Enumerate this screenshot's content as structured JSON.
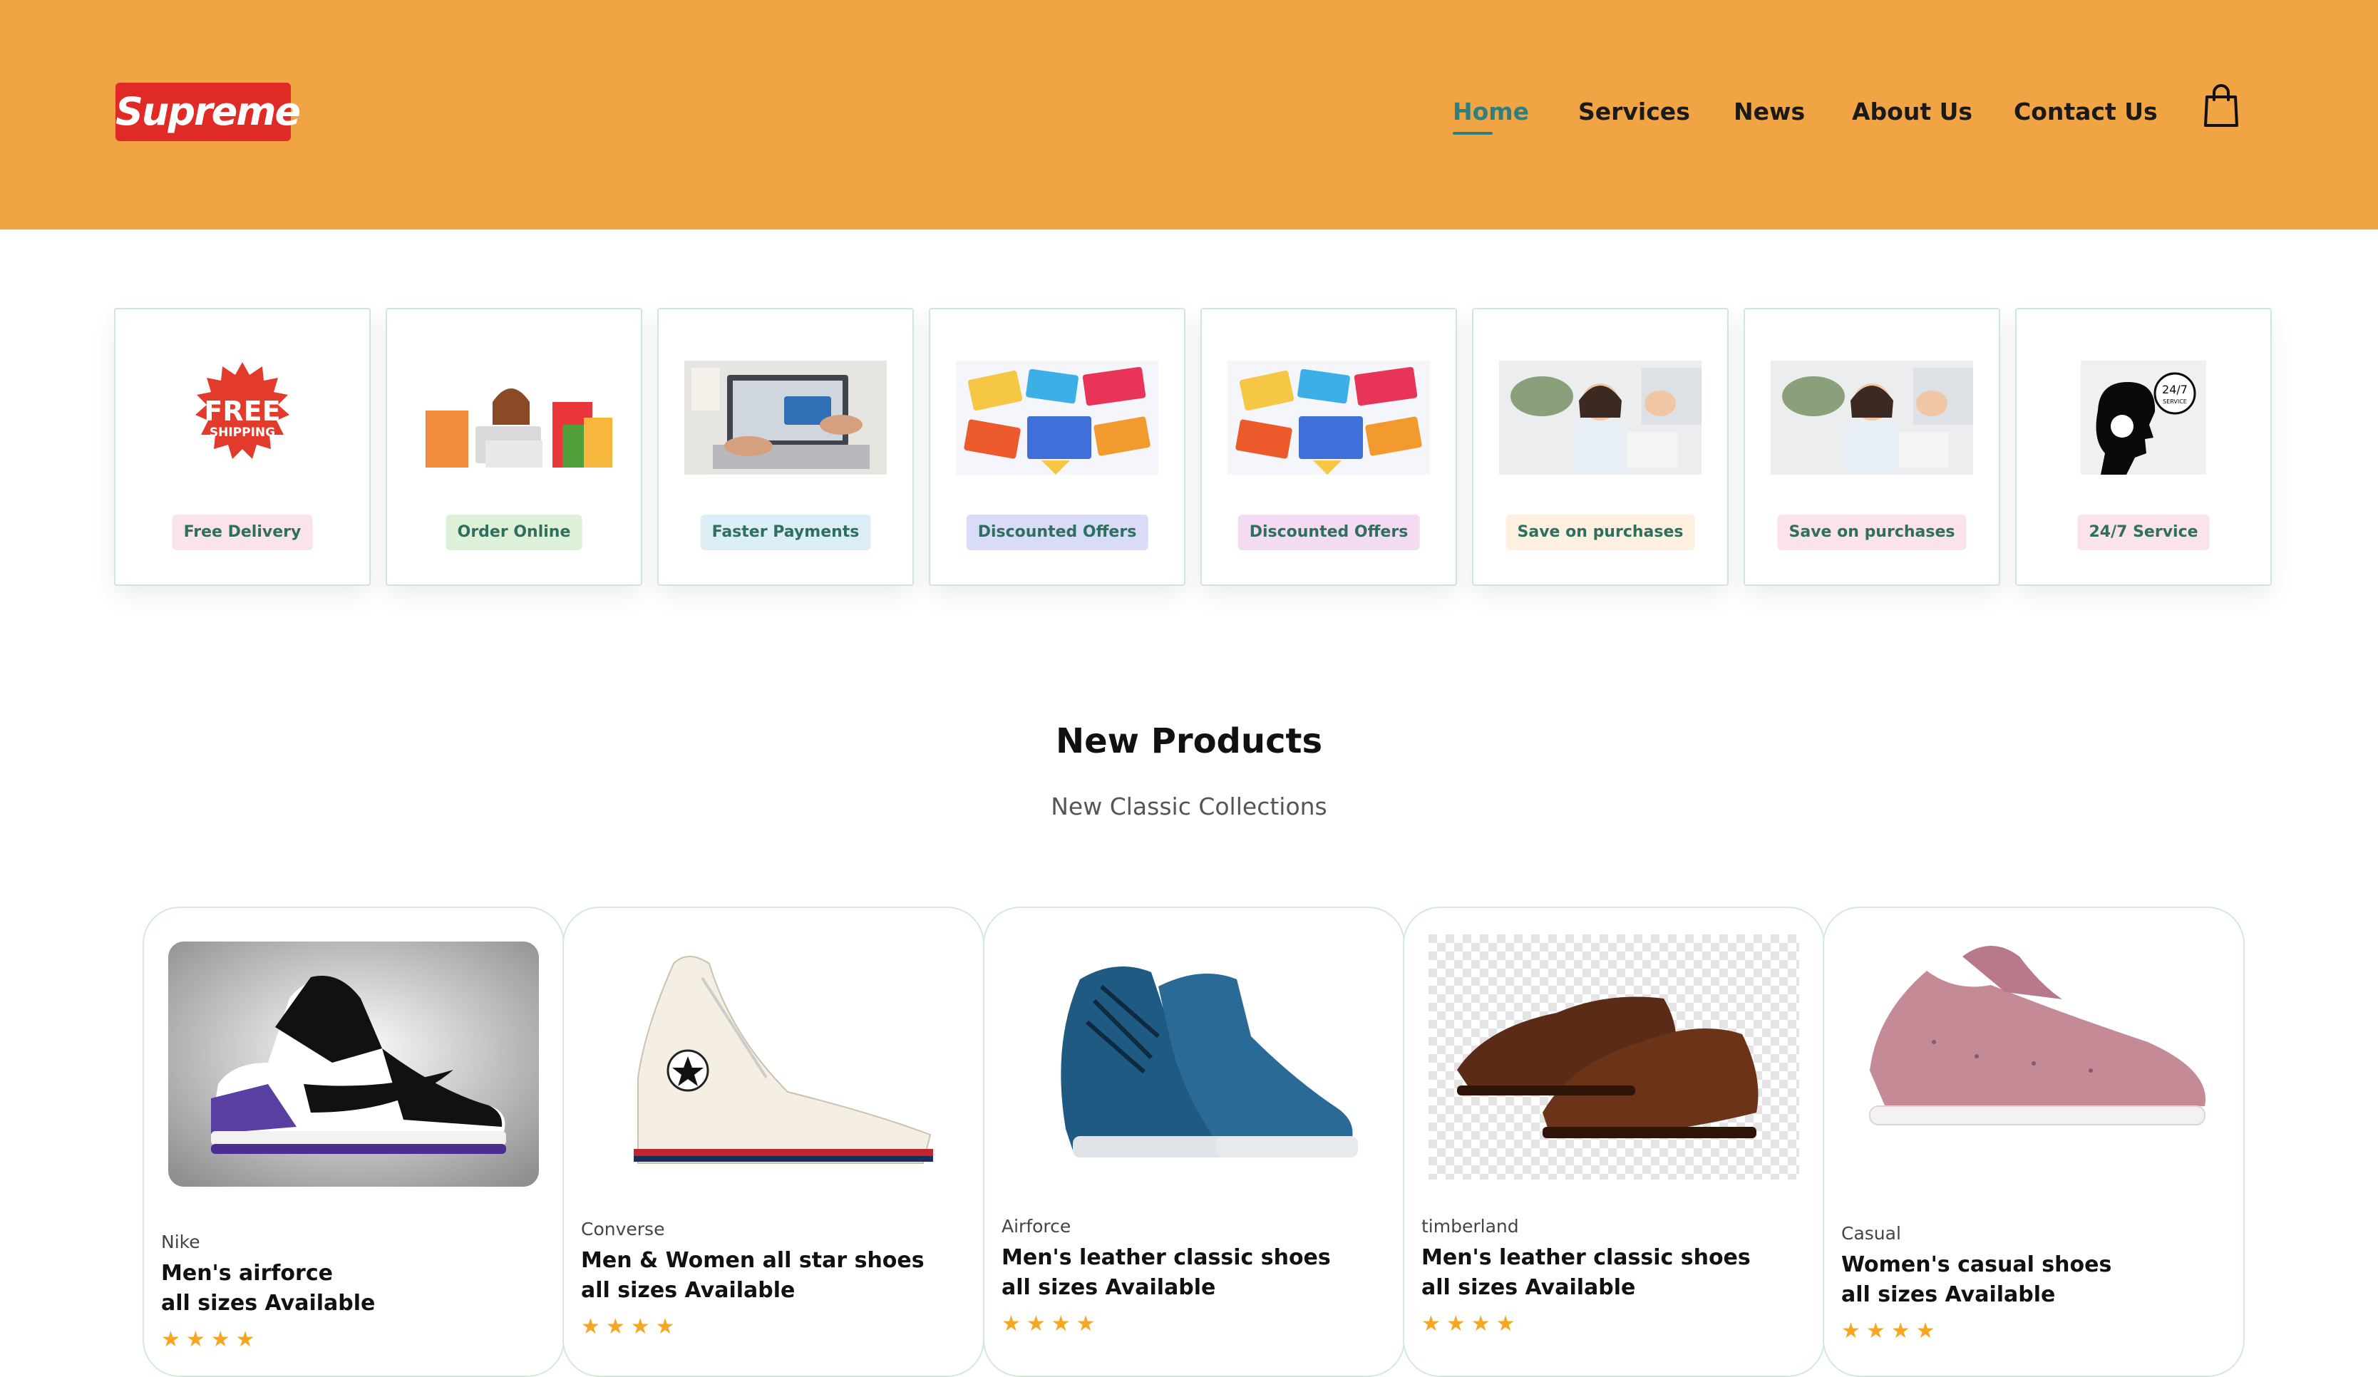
{
  "brand": {
    "logo_text": "Supreme",
    "color": "#e02a25"
  },
  "header": {
    "background": "#f1a443"
  },
  "nav": {
    "items": [
      {
        "label": "Home",
        "active": true
      },
      {
        "label": "Services"
      },
      {
        "label": "News"
      },
      {
        "label": "About Us"
      },
      {
        "label": "Contact Us"
      }
    ],
    "cart_icon": "shopping-bag-icon"
  },
  "services": [
    {
      "label": "Free Delivery",
      "image": "free-shipping-badge",
      "image_text": [
        "FREE",
        "SHIPPING"
      ],
      "tag_bg": "#fbe3ea",
      "tag_fg": "#2f6f5f"
    },
    {
      "label": "Order Online",
      "image": "woman-shopping-laptop",
      "tag_bg": "#dff0d8",
      "tag_fg": "#2f6f5f"
    },
    {
      "label": "Faster Payments",
      "image": "laptop-card-payment",
      "tag_bg": "#dbeef5",
      "tag_fg": "#2f6f5f"
    },
    {
      "label": "Discounted Offers",
      "image": "super-sale-banner",
      "tag_bg": "#d8dcf7",
      "tag_fg": "#2f6f5f"
    },
    {
      "label": "Discounted Offers",
      "image": "super-sale-banner",
      "tag_bg": "#f3dcf2",
      "tag_fg": "#2f6f5f"
    },
    {
      "label": "Save on purchases",
      "image": "woman-holding-money",
      "tag_bg": "#fdf0e0",
      "tag_fg": "#2f6f5f"
    },
    {
      "label": "Save on purchases",
      "image": "woman-holding-money",
      "tag_bg": "#fbe3ea",
      "tag_fg": "#2f6f5f"
    },
    {
      "label": "24/7 Service",
      "image": "support-headset",
      "image_text": [
        "24/7",
        "SERVICE"
      ],
      "tag_bg": "#fbe3ea",
      "tag_fg": "#2f6f5f"
    }
  ],
  "products_section": {
    "title": "New Products",
    "subtitle": "New Classic Collections"
  },
  "products": [
    {
      "brand": "Nike",
      "name_line1": "Men's airforce",
      "name_line2": "all sizes Available",
      "image": "nike-sneaker",
      "rating": 4,
      "stars": "★★★★"
    },
    {
      "brand": "Converse",
      "name_line1": "Men & Women all star shoes",
      "name_line2": "all sizes Available",
      "image": "converse-high-top",
      "rating": 4,
      "stars": "★★★★"
    },
    {
      "brand": "Airforce",
      "name_line1": "Men's leather classic shoes",
      "name_line2": "all sizes Available",
      "image": "blue-high-top-sneaker",
      "rating": 4,
      "stars": "★★★★"
    },
    {
      "brand": "timberland",
      "name_line1": "Men's leather classic shoes",
      "name_line2": "all sizes Available",
      "image": "brown-leather-oxford",
      "rating": 4,
      "stars": "★★★★"
    },
    {
      "brand": "Casual",
      "name_line1": "Women's casual shoes",
      "name_line2": "all sizes Available",
      "image": "pink-slip-on-sneaker",
      "rating": 4,
      "stars": "★★★★"
    }
  ]
}
